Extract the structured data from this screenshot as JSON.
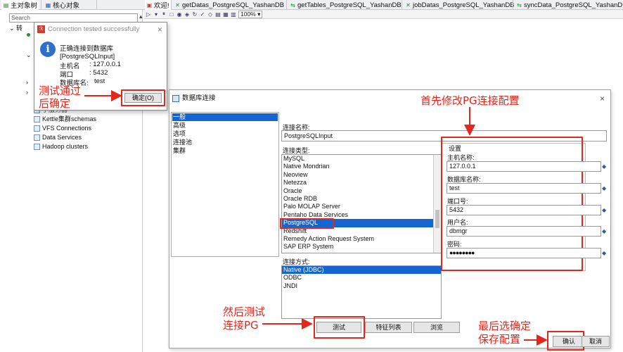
{
  "left_tabs": [
    {
      "label": "主对象树",
      "icon": "tree-icon"
    },
    {
      "label": "核心对象",
      "icon": "grid-icon"
    }
  ],
  "search": {
    "placeholder": "Search"
  },
  "tree": {
    "root": "转",
    "items": [
      {
        "label": "子服务器"
      },
      {
        "label": "Kettle集群schemas"
      },
      {
        "label": "VFS Connections"
      },
      {
        "label": "Data Services"
      },
      {
        "label": "Hadoop clusters"
      }
    ]
  },
  "editor_tabs": [
    {
      "label": "欢迎!",
      "icon": "welcome-icon"
    },
    {
      "label": "getDatas_PostgreSQL_YashanDB",
      "icon": "job-icon"
    },
    {
      "label": "getTables_PostgreSQL_YashanDB",
      "icon": "transform-icon"
    },
    {
      "label": "jobDatas_PostgreSQL_YashanDB",
      "icon": "job-icon"
    },
    {
      "label": "syncData_PostgreSQL_YashanDB",
      "icon": "transform-icon"
    }
  ],
  "toolbar": {
    "zoom": "100%",
    "icons": [
      "run-icon",
      "pause-icon",
      "stop-icon",
      "preview-icon",
      "debug-icon",
      "replay-icon",
      "verify-icon",
      "analyze-icon",
      "sql-icon",
      "explore-icon",
      "results-icon"
    ]
  },
  "popup": {
    "title": "Connection tested successfully",
    "message": "正确连接到数据库[PostgreSQLInput]",
    "host_label": "主机名",
    "host_value": ": 127.0.0.1",
    "port_label": "端口",
    "port_value": ": 5432",
    "db_label": "数据库名:",
    "db_value": "test",
    "ok": "确定(O)"
  },
  "dialog": {
    "title": "数据库连接",
    "categories": [
      "一般",
      "高级",
      "选项",
      "连接池",
      "集群"
    ],
    "conn_name_label": "连接名称:",
    "conn_name": "PostgreSQLInput",
    "conn_type_label": "连接类型:",
    "conn_types": [
      "MySQL",
      "Native Mondrian",
      "Neoview",
      "Netezza",
      "Oracle",
      "Oracle RDB",
      "Palo MOLAP Server",
      "Pentaho Data Services",
      "PostgreSQL",
      "Redshift",
      "Remedy Action Request System",
      "SAP ERP System"
    ],
    "conn_type_selected": "PostgreSQL",
    "access_label": "连接方式:",
    "access_types": [
      "Native (JDBC)",
      "ODBC",
      "JNDI"
    ],
    "access_selected": "Native (JDBC)",
    "settings": {
      "heading": "设置",
      "host_label": "主机名称:",
      "host": "127.0.0.1",
      "db_label": "数据库名称:",
      "db": "test",
      "port_label": "端口号:",
      "port": "5432",
      "user_label": "用户名:",
      "user": "dbmgr",
      "pass_label": "密码:",
      "pass": "●●●●●●●●"
    },
    "buttons": {
      "test": "测试",
      "features": "特征列表",
      "browse": "浏览",
      "ok": "确认",
      "cancel": "取消"
    }
  },
  "annotations": {
    "test_ok_line1": "测试通过",
    "test_ok_line2": "后确定",
    "modify_pg": "首先修改PG连接配置",
    "then_test_line1": "然后测试",
    "then_test_line2": "连接PG",
    "finally_line1": "最后选确定",
    "finally_line2": "保存配置"
  },
  "colors": {
    "annotation": "#e0281e",
    "selection": "#1565d0"
  }
}
